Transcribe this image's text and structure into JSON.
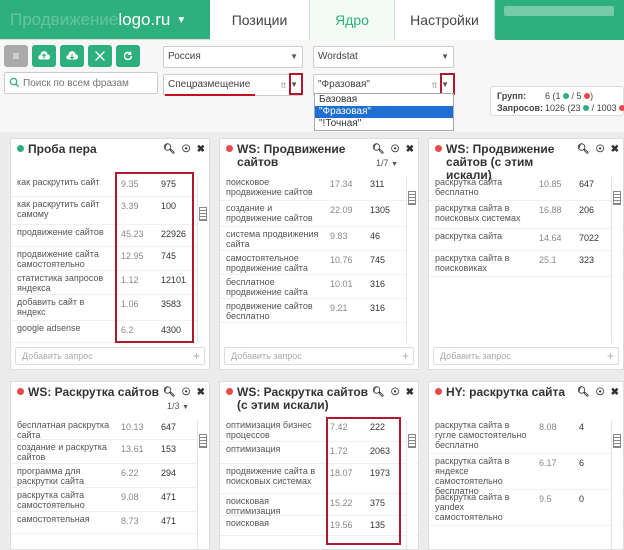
{
  "site": {
    "prefix": "Продвижение",
    "name": "logo.ru",
    "caret": "▼"
  },
  "tabs": [
    {
      "label": "Позиции",
      "active": false
    },
    {
      "label": "Ядро",
      "active": true
    },
    {
      "label": "Настройки",
      "active": false
    }
  ],
  "toolbar": {
    "region": "Россия",
    "source": "Wordstat",
    "search_placeholder": "Поиск по всем фразам",
    "group_select": "Спецразмещение",
    "match_select": "\"Фразовая\"",
    "group_icon": "tt",
    "match_icon": "tt"
  },
  "match_options": [
    {
      "label": "Базовая",
      "selected": false
    },
    {
      "label": "\"Фразовая\"",
      "selected": true
    },
    {
      "label": "\"!Точная\"",
      "selected": false
    }
  ],
  "stats": {
    "groups_label": "Групп:",
    "groups_value": "6 (1",
    "groups_mid": "/ 5",
    "groups_end": ")",
    "queries_label": "Запросов:",
    "queries_value": "1026 (23",
    "queries_mid": "/ 1003",
    "queries_end": ""
  },
  "add_query_label": "Добавить запрос",
  "colors": {
    "accent": "#2db07e",
    "red": "#e84a4a",
    "highlight": "#b2182b"
  },
  "panels": [
    {
      "title": "Проба пера",
      "dot": "#2db07e",
      "pager": "",
      "rows": [
        {
          "q": "как раскрутить сайт",
          "v1": "9.35",
          "v2": "975"
        },
        {
          "q": "как раскрутить сайт самому",
          "v1": "3.39",
          "v2": "100"
        },
        {
          "q": "продвижение сайтов",
          "v1": "45.23",
          "v2": "22926"
        },
        {
          "q": "продвижение сайта самостоятельно",
          "v1": "12.95",
          "v2": "745"
        },
        {
          "q": "статистика запросов яндекса",
          "v1": "1.12",
          "v2": "12101"
        },
        {
          "q": "добавить сайт в яндекс",
          "v1": "1.06",
          "v2": "3583"
        },
        {
          "q": "google adsense",
          "v1": "6.2",
          "v2": "4300"
        }
      ]
    },
    {
      "title": "WS: Продвижение сайтов",
      "dot": "#e84a4a",
      "pager": "1/7",
      "rows": [
        {
          "q": "поисковое продвижение сайтов",
          "v1": "17.34",
          "v2": "311"
        },
        {
          "q": "создание и продвижение сайтов",
          "v1": "22.09",
          "v2": "1305"
        },
        {
          "q": "система продвижения сайта",
          "v1": "9.83",
          "v2": "46"
        },
        {
          "q": "самостоятельное продвижение сайта",
          "v1": "10.76",
          "v2": "745"
        },
        {
          "q": "бесплатное продвижение сайта",
          "v1": "10.01",
          "v2": "316"
        },
        {
          "q": "продвижение сайтов бесплатно",
          "v1": "9.21",
          "v2": "316"
        }
      ]
    },
    {
      "title": "WS: Продвижение сайтов (с этим искали)",
      "dot": "#e84a4a",
      "pager": "",
      "rows": [
        {
          "q": "раскрутка сайта бесплатно",
          "v1": "10.85",
          "v2": "647"
        },
        {
          "q": "раскрутка сайта в поисковых системах",
          "v1": "16.88",
          "v2": "206"
        },
        {
          "q": "раскрутка сайта",
          "v1": "14.64",
          "v2": "7022"
        },
        {
          "q": "раскрутка сайта в поисковиках",
          "v1": "25.1",
          "v2": "323"
        }
      ]
    },
    {
      "title": "WS: Раскрутка сайтов",
      "dot": "#e84a4a",
      "pager": "1/3",
      "rows": [
        {
          "q": "бесплатная раскрутка сайта",
          "v1": "10.13",
          "v2": "647"
        },
        {
          "q": "создание и раскрутка сайтов",
          "v1": "13.61",
          "v2": "153"
        },
        {
          "q": "программа для раскрутки сайта",
          "v1": "6.22",
          "v2": "294"
        },
        {
          "q": "раскрутка сайта самостоятельно",
          "v1": "9.08",
          "v2": "471"
        },
        {
          "q": "самостоятельная",
          "v1": "8.73",
          "v2": "471"
        }
      ]
    },
    {
      "title": "WS: Раскрутка сайтов (с этим искали)",
      "dot": "#e84a4a",
      "pager": "",
      "rows": [
        {
          "q": "оптимизация бизнес процессов",
          "v1": "7.42",
          "v2": "222"
        },
        {
          "q": "оптимизация",
          "v1": "1.72",
          "v2": "2063"
        },
        {
          "q": "продвижение сайта в поисковых системах",
          "v1": "18.07",
          "v2": "1973"
        },
        {
          "q": "поисковая оптимизация",
          "v1": "15.22",
          "v2": "375"
        },
        {
          "q": "поисковая",
          "v1": "19.56",
          "v2": "135"
        }
      ]
    },
    {
      "title": "HY: раскрутка сайта",
      "dot": "#e84a4a",
      "pager": "",
      "rows": [
        {
          "q": "раскрутка сайта в гугле самостоятельно бесплатно",
          "v1": "8.08",
          "v2": "4"
        },
        {
          "q": "раскрутка сайта в яндексе самостоятельно бесплатно",
          "v1": "6.17",
          "v2": "6"
        },
        {
          "q": "раскрутка сайта в yandex самостоятельно",
          "v1": "9.5",
          "v2": "0"
        }
      ]
    }
  ]
}
